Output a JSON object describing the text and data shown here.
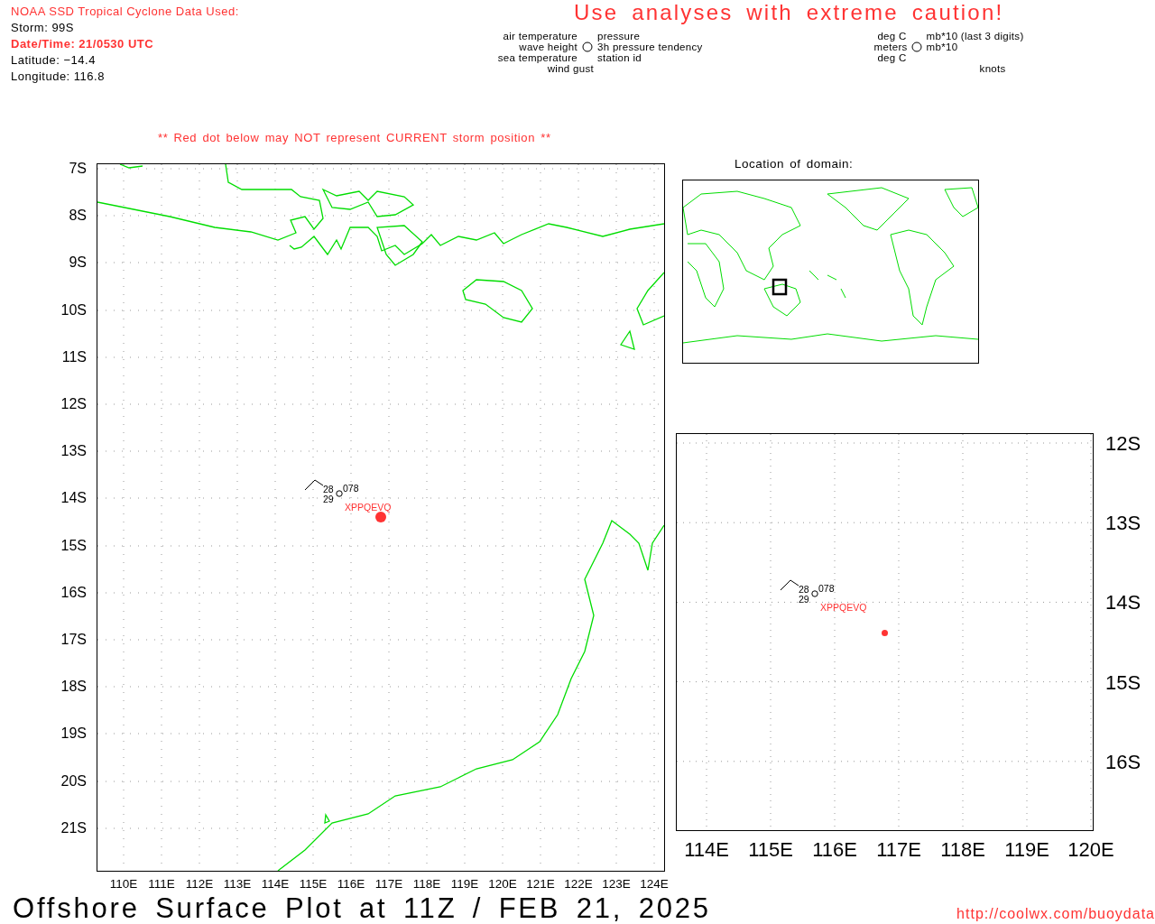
{
  "header": {
    "source_title": "NOAA SSD Tropical Cyclone Data Used:",
    "storm": "Storm: 99S",
    "datetime": "Date/Time: 21/0530 UTC",
    "latitude": "Latitude: −14.4",
    "longitude": "Longitude: 116.8"
  },
  "caution": "Use analyses with extreme caution!",
  "legend": {
    "left_labels": [
      "air temperature",
      "wave height",
      "sea temperature"
    ],
    "right_labels": [
      "pressure",
      "3h pressure tendency",
      "station id"
    ],
    "bottom": "wind gust"
  },
  "units": {
    "left_labels": [
      "deg C",
      "meters",
      "deg C"
    ],
    "right_labels": [
      "mb*10 (last 3 digits)",
      "mb*10"
    ],
    "bottom": "knots"
  },
  "warning": "** Red dot below may NOT represent CURRENT storm position **",
  "main_map": {
    "lat_labels": [
      "7S",
      "8S",
      "9S",
      "10S",
      "11S",
      "12S",
      "13S",
      "14S",
      "15S",
      "16S",
      "17S",
      "18S",
      "19S",
      "20S",
      "21S"
    ],
    "lon_labels": [
      "110E",
      "111E",
      "112E",
      "113E",
      "114E",
      "115E",
      "116E",
      "117E",
      "118E",
      "119E",
      "120E",
      "121E",
      "122E",
      "123E",
      "124E"
    ],
    "station": {
      "air_temp": "28",
      "sea_temp": "29",
      "pressure": "078",
      "id": "XPPQEVQ"
    }
  },
  "domain": {
    "title": "Location of domain:"
  },
  "zoom_map": {
    "lat_labels": [
      "12S",
      "13S",
      "14S",
      "15S",
      "16S"
    ],
    "lon_labels": [
      "114E",
      "115E",
      "116E",
      "117E",
      "118E",
      "119E",
      "120E"
    ],
    "station": {
      "air_temp": "28",
      "sea_temp": "29",
      "pressure": "078",
      "id": "XPPQEVQ"
    }
  },
  "footer": {
    "title": "Offshore Surface Plot at 11Z / FEB 21, 2025",
    "url": "http://coolwx.com/buoydata"
  }
}
